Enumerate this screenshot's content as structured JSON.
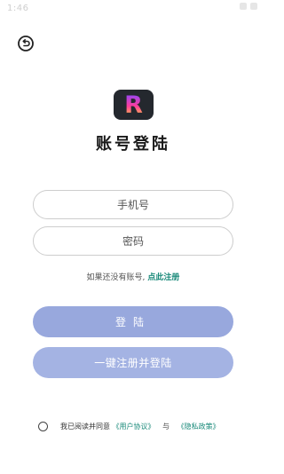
{
  "status_bar": {
    "time": "1:46"
  },
  "header": {
    "back_icon": "back-arrow-icon"
  },
  "logo": {
    "letter": "R",
    "bg_color": "#24282e"
  },
  "title": "账号登陆",
  "form": {
    "phone_placeholder": "手机号",
    "password_placeholder": "密码"
  },
  "register_hint": {
    "text": "如果还没有账号,",
    "link": "点此注册"
  },
  "buttons": {
    "login": "登陆",
    "quick_register_login": "一键注册并登陆"
  },
  "agreement": {
    "prefix": "我已阅读并同意",
    "user_agreement": "《用户协议》",
    "conjunction": "与",
    "privacy_policy": "《隐私政策》"
  },
  "colors": {
    "accent_link": "#1a8a7a",
    "button_login": "#98a8dd",
    "button_quick": "#a4b3e3"
  }
}
